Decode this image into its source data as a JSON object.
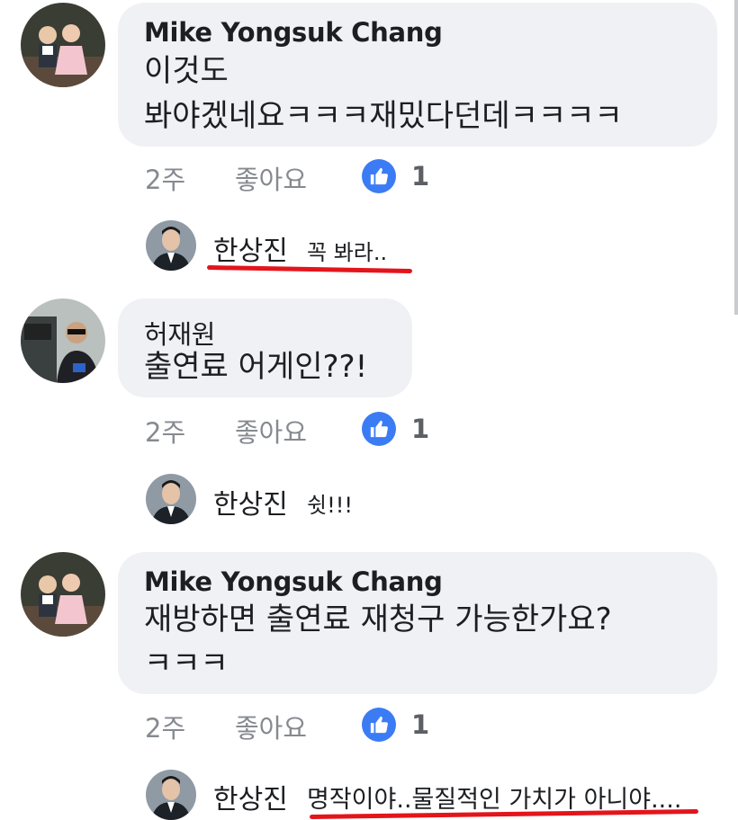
{
  "comments": [
    {
      "author": "Mike Yongsuk Chang",
      "lines": [
        "이것도",
        "봐야겠네요ㅋㅋㅋ재밌다던데ㅋㅋㅋㅋ"
      ],
      "time": "2주",
      "like_label": "좋아요",
      "like_count": "1",
      "reply": {
        "author": "한상진",
        "text": "꼭 봐라.."
      }
    },
    {
      "author": "허재원",
      "lines": [
        "출연료 어게인??!"
      ],
      "time": "2주",
      "like_label": "좋아요",
      "like_count": "1",
      "reply": {
        "author": "한상진",
        "text": "쉿!!!"
      }
    },
    {
      "author": "Mike Yongsuk Chang",
      "lines": [
        "재방하면 출연료 재청구 가능한가요?",
        "ㅋㅋㅋ"
      ],
      "time": "2주",
      "like_label": "좋아요",
      "like_count": "1",
      "reply": {
        "author": "한상진",
        "text": "명작이야..물질적인 가치가 아니야...."
      }
    }
  ],
  "colors": {
    "like_badge": "#3b7cf5",
    "bubble": "#f0f1f4",
    "annotation": "#e3151b"
  },
  "icons": {
    "like": "thumbs-up-icon"
  }
}
